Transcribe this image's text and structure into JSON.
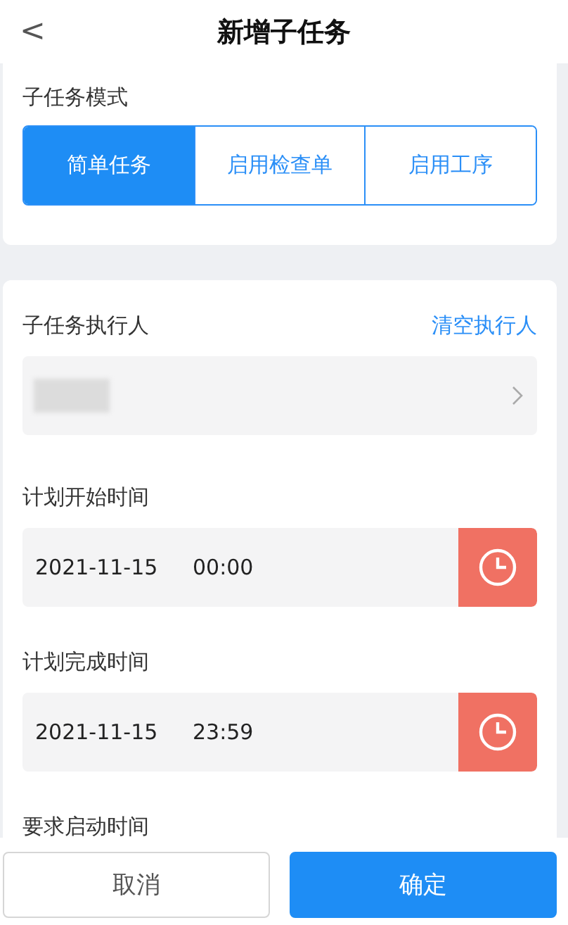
{
  "header": {
    "back": "<",
    "title": "新增子任务"
  },
  "mode": {
    "label": "子任务模式",
    "options": [
      {
        "label": "简单任务",
        "selected": true
      },
      {
        "label": "启用检查单",
        "selected": false
      },
      {
        "label": "启用工序",
        "selected": false
      }
    ]
  },
  "executor": {
    "label": "子任务执行人",
    "clear": "清空执行人",
    "value": {
      "kind": "redacted"
    }
  },
  "times": [
    {
      "label": "计划开始时间",
      "date": "2021-11-15",
      "time": "00:00"
    },
    {
      "label": "计划完成时间",
      "date": "2021-11-15",
      "time": "23:59"
    }
  ],
  "next_label": "要求启动时间",
  "footer": {
    "cancel": "取消",
    "confirm": "确定"
  }
}
